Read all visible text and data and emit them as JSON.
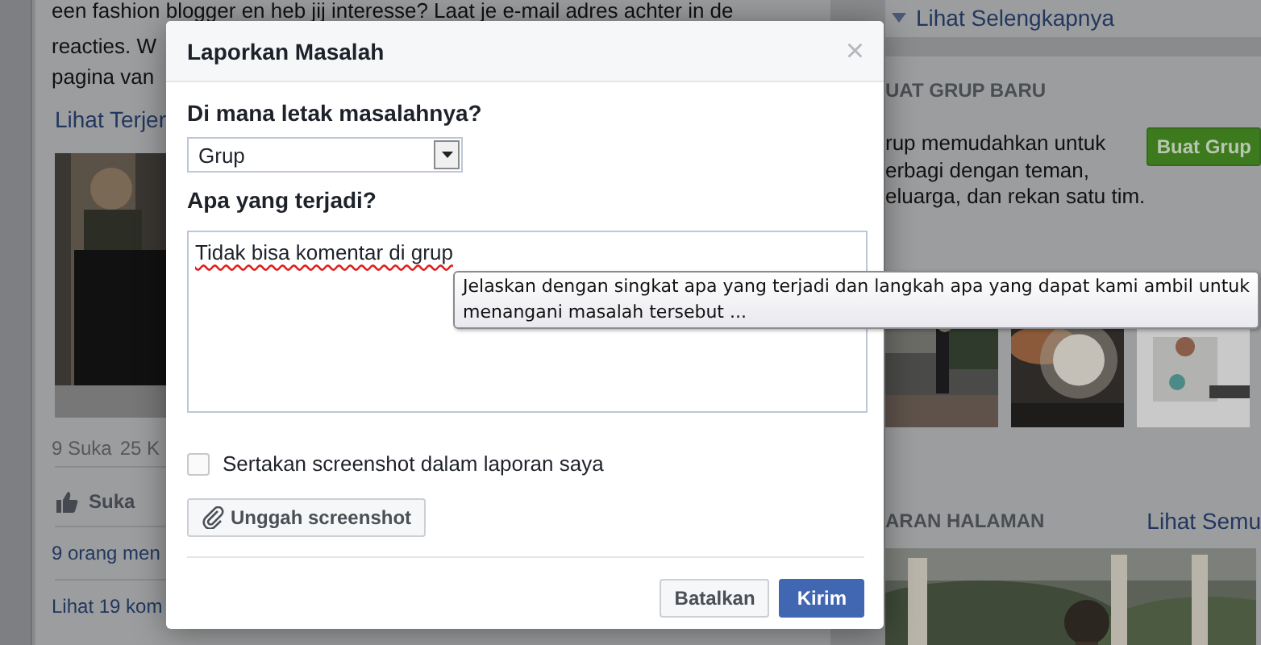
{
  "background": {
    "left_feed": {
      "post_lines": [
        "een fashion blogger en heb jij interesse? Laat je e-mail adres achter in de",
        "reacties. W",
        "pagina van"
      ],
      "see_more": "Lihat Terjer",
      "stats": [
        "9 Suka",
        "25 K"
      ],
      "like_button": "Suka",
      "likers": "9 orang men",
      "comments_link": "Lihat 19 kom"
    },
    "right_column": {
      "see_more": "Lihat Selengkapnya",
      "create_group": {
        "heading": "UAT GRUP BARU",
        "text": "rup memudahkan untuk\nerbagi dengan teman,\neluarga, dan rekan satu tim.",
        "button": "Buat Grup"
      },
      "suggested_pages": {
        "heading": "ARAN HALAMAN",
        "see_all": "Lihat Semu"
      }
    }
  },
  "dialog": {
    "title": "Laporkan Masalah",
    "close": "×",
    "where_label": "Di mana letak masalahnya?",
    "where_select": {
      "value": "Grup"
    },
    "what_label": "Apa yang terjadi?",
    "what_field": {
      "value": "Tidak bisa komentar di grup"
    },
    "screenshot_checkbox": {
      "label": "Sertakan screenshot dalam laporan saya",
      "checked": false
    },
    "upload_button": "Unggah screenshot",
    "buttons": [
      {
        "label": "Batalkan",
        "kind": "secondary"
      },
      {
        "label": "Kirim",
        "kind": "primary"
      }
    ]
  },
  "tooltip": {
    "text": "Jelaskan dengan singkat apa yang terjadi dan langkah apa yang dapat kami ambil untuk\nmenangani masalah tersebut ..."
  }
}
